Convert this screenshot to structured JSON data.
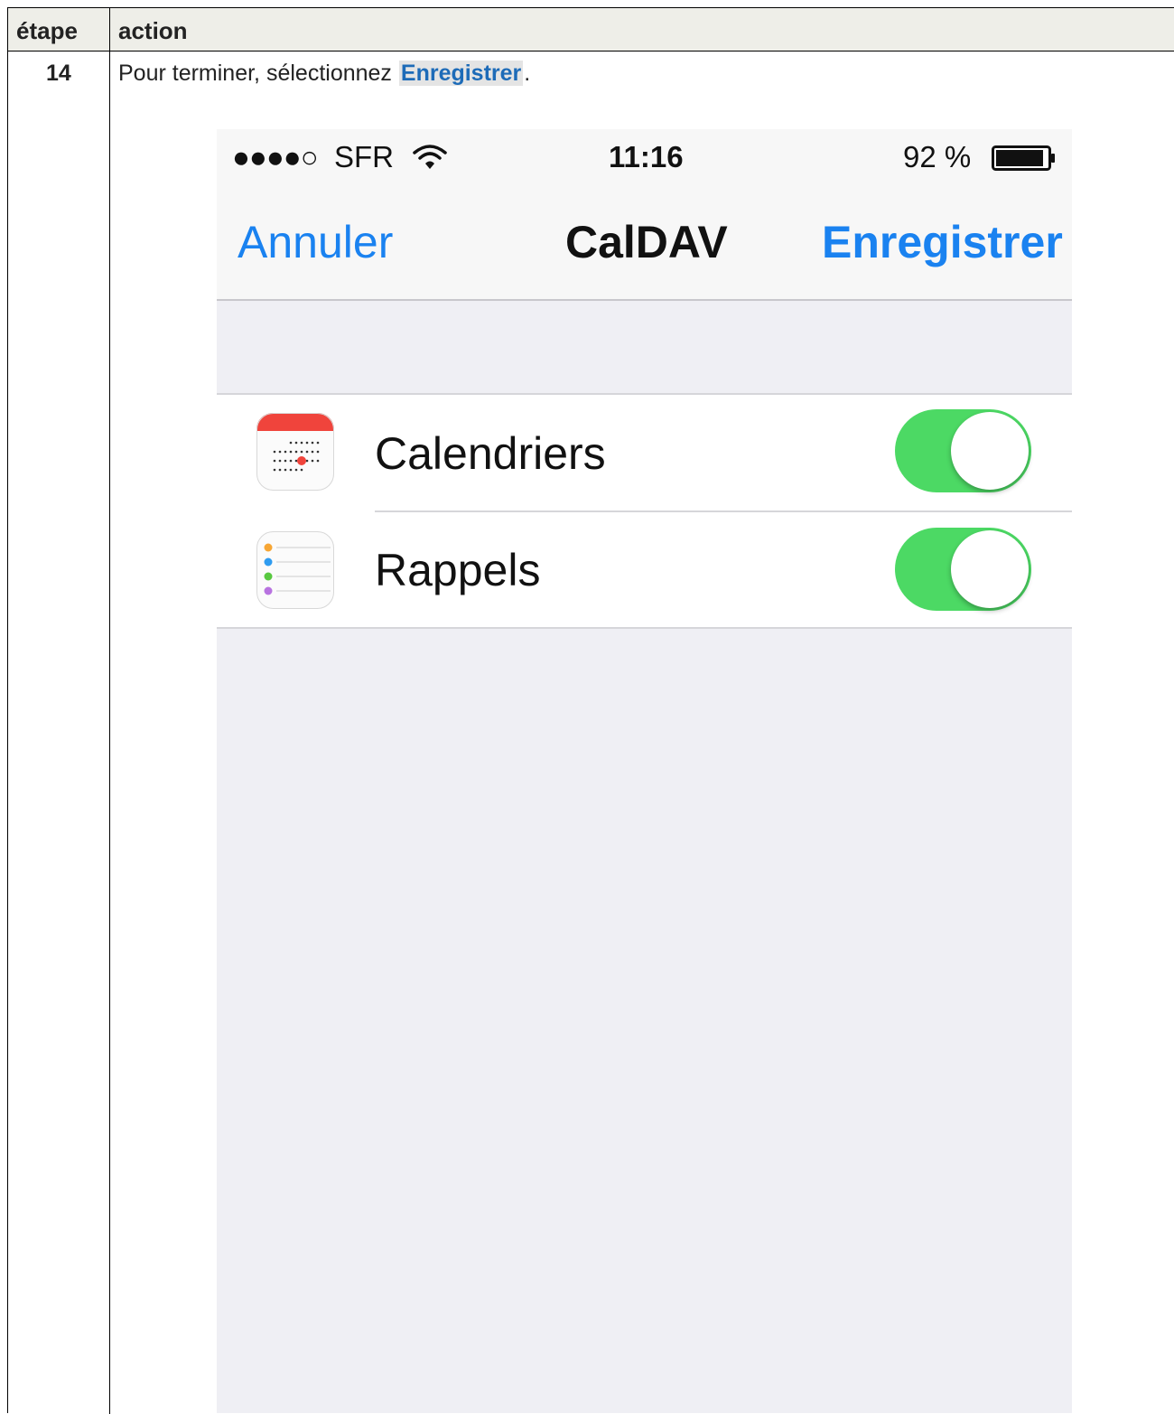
{
  "table": {
    "header": {
      "step": "étape",
      "action": "action"
    },
    "row": {
      "step": "14",
      "instruction_prefix": "Pour terminer, sélectionnez ",
      "instruction_highlight": "Enregistrer",
      "instruction_suffix": "."
    }
  },
  "phone": {
    "status_bar": {
      "signal": "●●●●○",
      "carrier": "SFR",
      "time": "11:16",
      "battery": "92 %"
    },
    "nav_bar": {
      "cancel_label": "Annuler",
      "title": "CalDAV",
      "save_label": "Enregistrer"
    },
    "cells": [
      {
        "label": "Calendriers",
        "toggle_on": true,
        "icon": "calendar-icon"
      },
      {
        "label": "Rappels",
        "toggle_on": true,
        "icon": "reminders-icon"
      }
    ],
    "colors": {
      "accent": "#1a82f0",
      "toggle_on": "#4cd964",
      "background": "#efeff4"
    }
  }
}
